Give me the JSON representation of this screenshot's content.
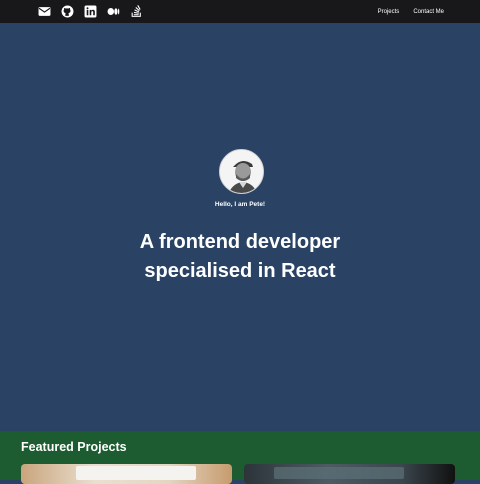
{
  "socials": [
    {
      "icon": "mail-icon"
    },
    {
      "icon": "github-icon"
    },
    {
      "icon": "linkedin-icon"
    },
    {
      "icon": "medium-icon"
    },
    {
      "icon": "stackoverflow-icon"
    }
  ],
  "nav": {
    "projects": "Projects",
    "contact": "Contact Me"
  },
  "hero": {
    "greeting": "Hello, I am Pete!",
    "headline_line1": "A frontend developer",
    "headline_line2": "specialised in React"
  },
  "featured": {
    "title": "Featured Projects"
  },
  "colors": {
    "topbar": "#18181b",
    "hero_bg": "#2a4365",
    "featured_bg": "#1d5c30"
  }
}
